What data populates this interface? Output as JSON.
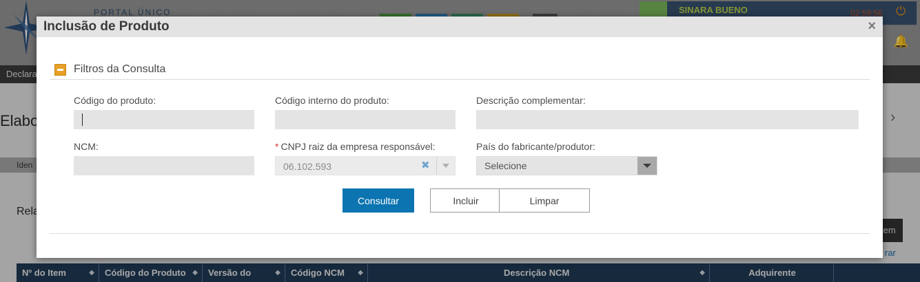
{
  "background": {
    "portal_label": "PORTAL ÚNICO",
    "user": {
      "name": "SINARA BUENO",
      "session_timer": "02:59:56"
    },
    "nav_label": "Declara",
    "page_title": "Elabo",
    "tab_label": "Iden",
    "section_label": "Rela",
    "item_button_label": "tem",
    "filter_link": "rar",
    "table_headers": [
      {
        "label": "Nº do Item"
      },
      {
        "label": "Código do Produto"
      },
      {
        "label": "Versão do"
      },
      {
        "label": "Código NCM"
      },
      {
        "label": "Descrição NCM"
      },
      {
        "label": "Adquirente"
      },
      {
        "label": ""
      }
    ]
  },
  "modal": {
    "title": "Inclusão de Produto",
    "close_glyph": "×",
    "section_title": "Filtros da Consulta",
    "fields": {
      "codigo_produto": {
        "label": "Código do produto:",
        "value": ""
      },
      "codigo_interno": {
        "label": "Código interno do produto:",
        "value": ""
      },
      "descricao_complementar": {
        "label": "Descrição complementar:",
        "value": ""
      },
      "ncm": {
        "label": "NCM:",
        "value": ""
      },
      "cnpj": {
        "label": "CNPJ raiz da empresa responsável:",
        "required_mark": "*",
        "value": "06.102.593",
        "clear_glyph": "✖"
      },
      "pais": {
        "label": "País do fabricante/produtor:",
        "value": "Selecione"
      }
    },
    "buttons": {
      "consultar": "Consultar",
      "incluir": "Incluir",
      "limpar": "Limpar"
    }
  },
  "icons": {
    "compass_logo": "compass-rose-icon",
    "power": "power-icon",
    "bell": "bell-icon",
    "chevron": "chevron-right-icon",
    "collapse": "minus-square-icon",
    "close": "close-icon"
  },
  "colors": {
    "primary_button": "#0c74b0",
    "section_toggle": "#e8a028",
    "required": "#d43c3c",
    "table_header": "#1f3a55"
  }
}
